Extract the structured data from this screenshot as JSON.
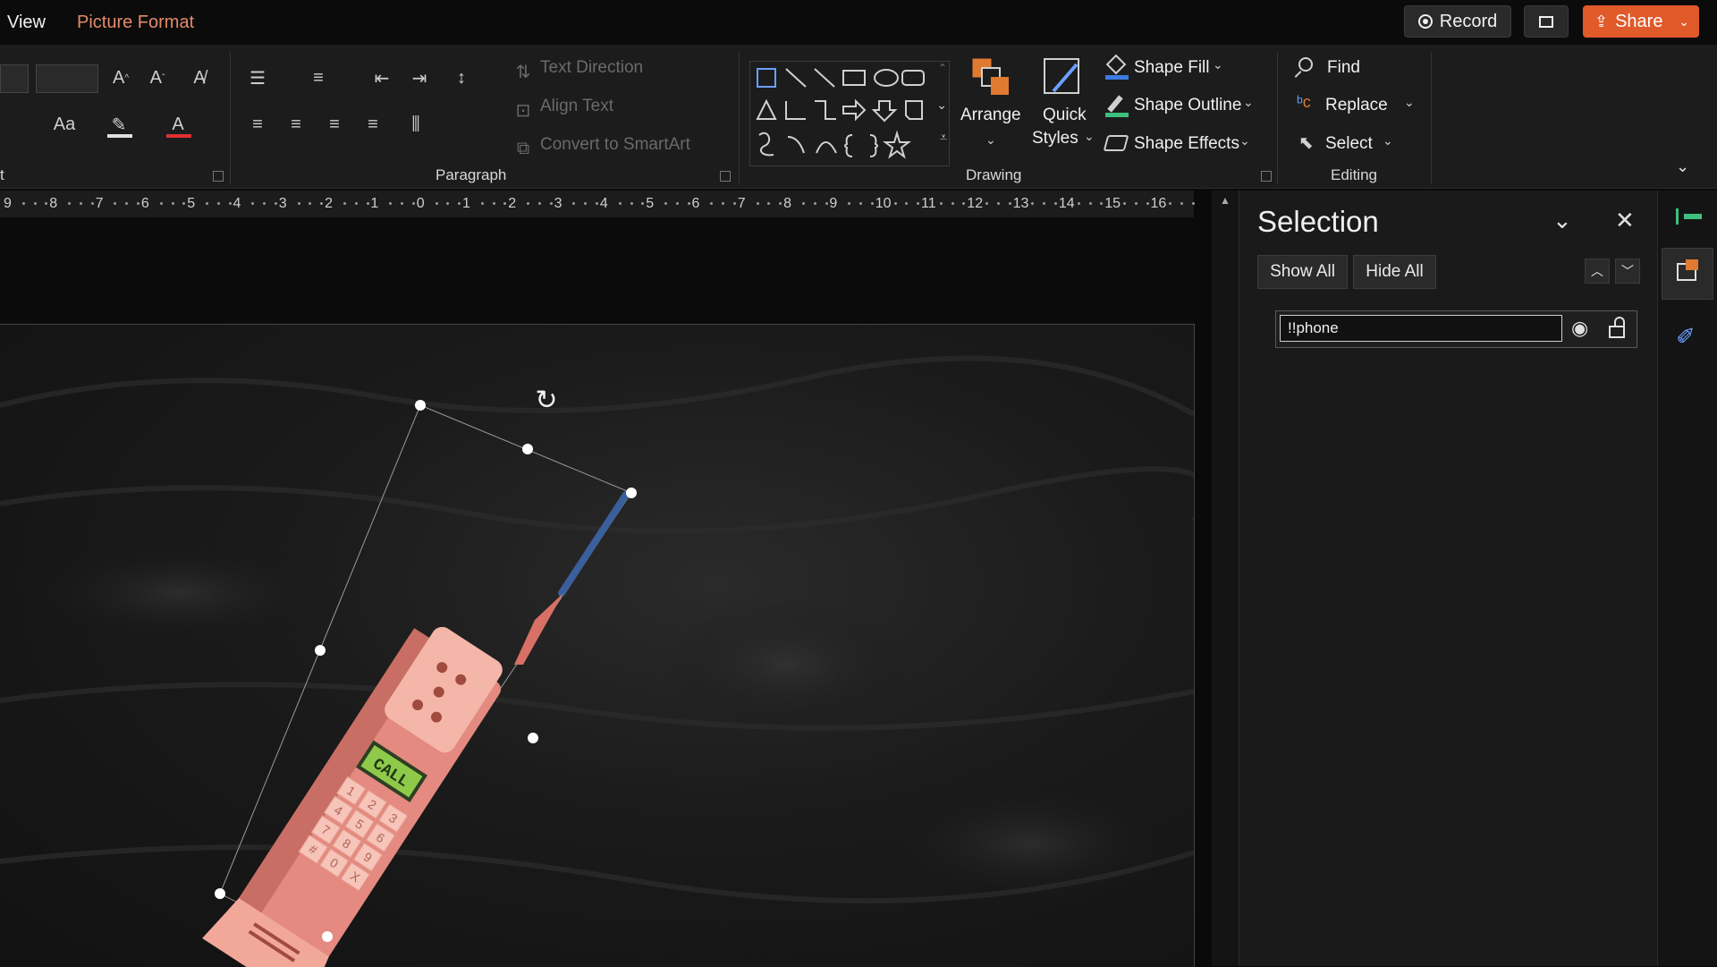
{
  "tabs": {
    "view": "View",
    "picture_format": "Picture Format"
  },
  "toolbar_right": {
    "record": "Record",
    "share": "Share"
  },
  "ribbon": {
    "paragraph": {
      "text_direction": "Text Direction",
      "align_text": "Align Text",
      "convert_smartart": "Convert to SmartArt",
      "group_label": "Paragraph"
    },
    "font_group_label_fragment": "t",
    "drawing": {
      "arrange": "Arrange",
      "quick_styles_line1": "Quick",
      "quick_styles_line2": "Styles",
      "shape_fill": "Shape Fill",
      "shape_outline": "Shape Outline",
      "shape_effects": "Shape Effects",
      "group_label": "Drawing"
    },
    "editing": {
      "find": "Find",
      "replace": "Replace",
      "select": "Select",
      "group_label": "Editing"
    }
  },
  "ruler": {
    "labels": [
      "9",
      "8",
      "7",
      "6",
      "5",
      "4",
      "3",
      "2",
      "1",
      "0",
      "1",
      "2",
      "3",
      "4",
      "5",
      "6",
      "7",
      "8",
      "9",
      "10",
      "11",
      "12",
      "13",
      "14",
      "15",
      "16"
    ]
  },
  "slide": {
    "phone_screen_text": "CALL",
    "keypad": [
      "1",
      "2",
      "3",
      "4",
      "5",
      "6",
      "7",
      "8",
      "9",
      "#",
      "0",
      "X"
    ]
  },
  "selection_pane": {
    "title": "Selection",
    "show_all": "Show All",
    "hide_all": "Hide All",
    "item_name_value": "!!phone"
  },
  "colors": {
    "accent_orange": "#e05a2a",
    "tab_active": "#e58a6a",
    "phone_body": "#e8857a",
    "phone_screen": "#8fc94a"
  }
}
